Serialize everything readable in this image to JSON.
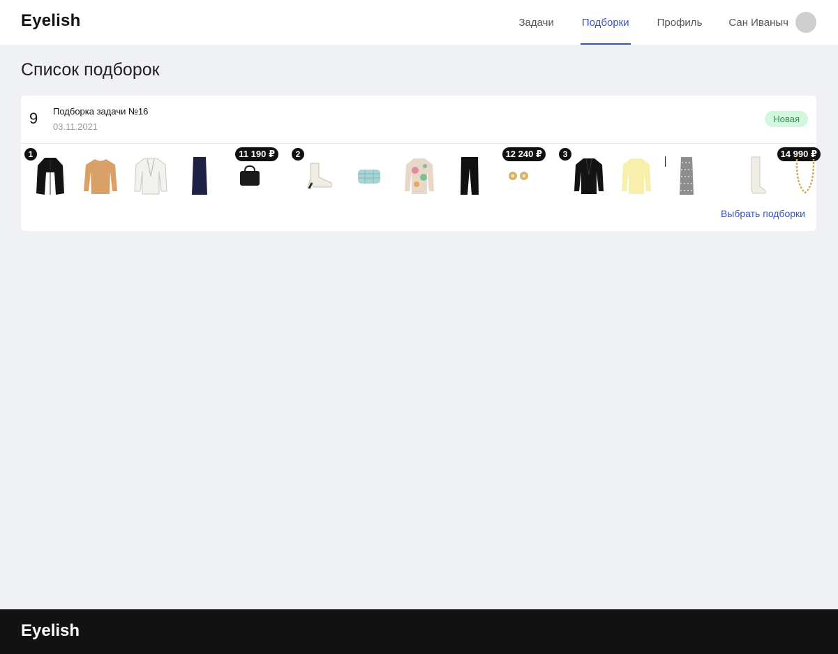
{
  "header": {
    "logo": "Eyelish",
    "nav": [
      {
        "label": "Задачи",
        "active": false
      },
      {
        "label": "Подборки",
        "active": true
      },
      {
        "label": "Профиль",
        "active": false
      }
    ],
    "user_name": "Сан Иваныч"
  },
  "page": {
    "title": "Список подборок"
  },
  "card": {
    "count": "9",
    "title": "Подборка задачи №16",
    "date": "03.11.2021",
    "status_badge": "Новая",
    "sets": [
      {
        "number": "1",
        "price": "11 190 ₽",
        "items": [
          "black-coat-icon",
          "beige-sweater-icon",
          "white-jacket-icon",
          "navy-skirt-icon",
          "black-bag-icon"
        ]
      },
      {
        "number": "2",
        "price": "12 240 ₽",
        "items": [
          "white-boots-icon",
          "mint-bag-icon",
          "floral-jacket-icon",
          "black-trousers-icon",
          "gold-earrings-icon"
        ]
      },
      {
        "number": "3",
        "price": "14 990 ₽",
        "items": [
          "black-blazer-icon",
          "yellow-blouse-icon",
          "print-skirt-icon",
          "white-tall-boots-icon",
          "gold-necklace-icon"
        ]
      }
    ],
    "choose_link": "Выбрать подборки"
  },
  "footer": {
    "logo": "Eyelish"
  },
  "colors": {
    "accent": "#3a55b8",
    "badge_bg": "#d3f6df",
    "badge_text": "#3c8a54",
    "footer_bg": "#121212",
    "page_bg": "#f0f1f5"
  }
}
